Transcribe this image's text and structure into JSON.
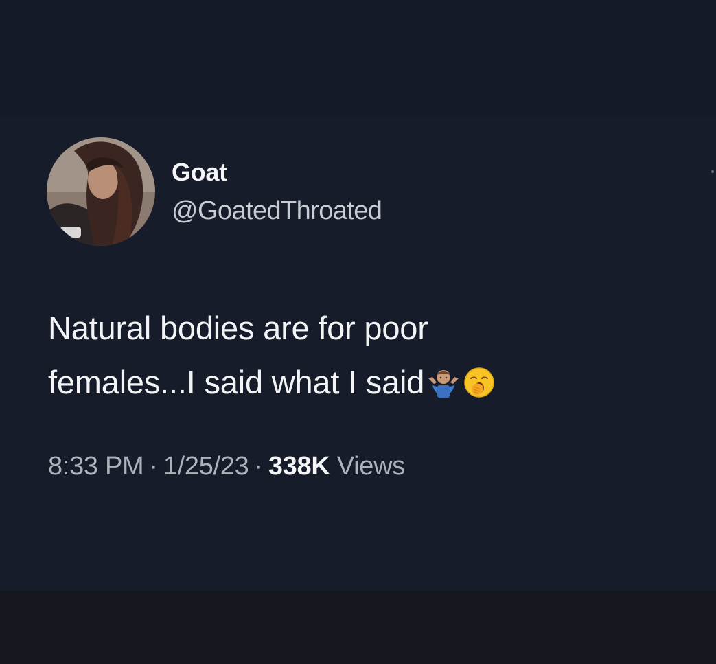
{
  "tweet": {
    "display_name": "Goat",
    "handle": "@GoatedThroated",
    "text_line1": "Natural bodies are for poor",
    "text_line2": "females...I said what I said",
    "emojis": [
      "person-shrugging-icon",
      "yawning-face-icon"
    ],
    "time": "8:33 PM",
    "separator": "·",
    "date": "1/25/23",
    "views_count": "338K",
    "views_label": "Views"
  },
  "colors": {
    "background": "#171c2b",
    "text_primary": "#f3f4f6",
    "text_secondary": "#aeb2bb"
  }
}
